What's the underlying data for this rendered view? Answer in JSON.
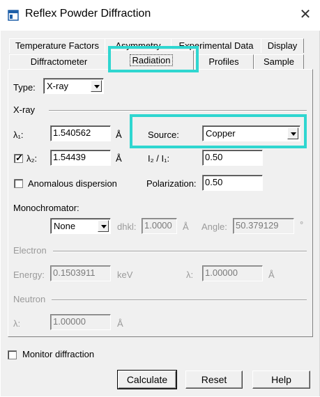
{
  "window": {
    "title": "Reflex Powder Diffraction",
    "close_glyph": "✕",
    "icon": "app-window-icon"
  },
  "tabs": {
    "row1": [
      "Temperature Factors",
      "Asymmetry",
      "Experimental Data",
      "Display"
    ],
    "row2": [
      "Diffractometer",
      "Radiation",
      "Profiles",
      "Sample"
    ],
    "active": "Radiation"
  },
  "radiation": {
    "type_label": "Type:",
    "type_value": "X-ray",
    "xray_group": "X-ray",
    "lambda1_label": "λ₁:",
    "lambda1_value": "1.540562",
    "lambda1_unit": "Å",
    "source_label": "Source:",
    "source_value": "Copper",
    "lambda2_label": "λ₂:",
    "lambda2_value": "1.54439",
    "lambda2_unit": "Å",
    "lambda2_checked": true,
    "ratio_label": "I₂ / I₁:",
    "ratio_value": "0.50",
    "anomalous_label": "Anomalous dispersion",
    "anomalous_checked": false,
    "polarization_label": "Polarization:",
    "polarization_value": "0.50",
    "monochromator_label": "Monochromator:",
    "monochromator_value": "None",
    "dhkl_label": "dhkl:",
    "dhkl_value": "1.0000",
    "dhkl_unit": "Å",
    "angle_label": "Angle:",
    "angle_value": "50.379129",
    "angle_unit": "°",
    "electron_group": "Electron",
    "energy_label": "Energy:",
    "energy_value": "0.1503911",
    "energy_unit": "keV",
    "e_lambda_label": "λ:",
    "e_lambda_value": "1.00000",
    "e_lambda_unit": "Å",
    "neutron_group": "Neutron",
    "n_lambda_label": "λ:",
    "n_lambda_value": "1.00000",
    "n_lambda_unit": "Å"
  },
  "footer": {
    "monitor_label": "Monitor diffraction",
    "monitor_checked": false,
    "calculate": "Calculate",
    "reset": "Reset",
    "help": "Help"
  },
  "colors": {
    "highlight": "#2fd6d0",
    "background": "#f0f0f0"
  }
}
